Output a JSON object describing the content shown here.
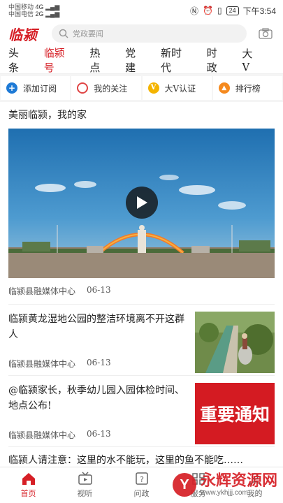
{
  "status": {
    "carrier1": "中国移动",
    "carrier2": "中国电信",
    "net1": "4G",
    "net2": "2G",
    "battery": "24",
    "time": "下午3:54"
  },
  "header": {
    "logo": "临颍",
    "search_placeholder": "党政要闻"
  },
  "tabs": [
    {
      "label": "头条"
    },
    {
      "label": "临颍号"
    },
    {
      "label": "热点"
    },
    {
      "label": "党建"
    },
    {
      "label": "新时代"
    },
    {
      "label": "时政"
    },
    {
      "label": "大V"
    }
  ],
  "quick_actions": [
    {
      "label": "添加订阅",
      "icon": "plus-icon",
      "glyph": "+"
    },
    {
      "label": "我的关注",
      "icon": "follow-ring-icon",
      "glyph": ""
    },
    {
      "label": "大V认证",
      "icon": "verified-icon",
      "glyph": "V"
    },
    {
      "label": "排行榜",
      "icon": "ranking-icon",
      "glyph": "▲"
    }
  ],
  "feed": {
    "video": {
      "title": "美丽临颍，我的家",
      "source": "临颍县融媒体中心",
      "date": "06-13"
    },
    "articles": [
      {
        "title": "临颍黄龙湿地公园的整洁环境离不开这群人",
        "source": "临颍县融媒体中心",
        "date": "06-13"
      },
      {
        "title": "@临颍家长，秋季幼儿园入园体检时间、地点公布!",
        "source": "临颍县融媒体中心",
        "date": "06-13",
        "thumb_text": "重要通知"
      }
    ],
    "partial_title": "临颍人请注意：这里的水不能玩，这里的鱼不能吃……"
  },
  "bottom_nav": [
    {
      "label": "首页",
      "icon": "home-icon"
    },
    {
      "label": "视听",
      "icon": "tv-icon"
    },
    {
      "label": "问政",
      "icon": "question-icon"
    },
    {
      "label": "服务",
      "icon": "service-icon"
    },
    {
      "label": "我的",
      "icon": "user-icon"
    }
  ],
  "watermark": {
    "main": "永辉资源网",
    "sub": "www.ykhjjj.com",
    "logo": "Y"
  },
  "colors": {
    "accent": "#d61f26",
    "tab_active": "#d61f26"
  }
}
